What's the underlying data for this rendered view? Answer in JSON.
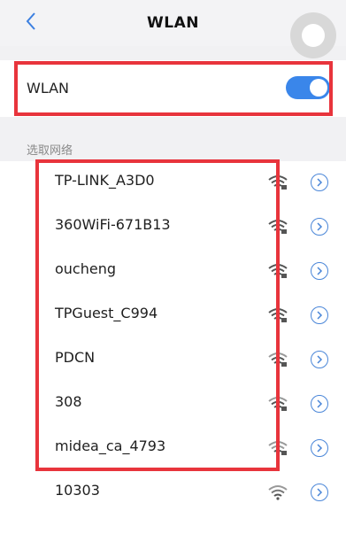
{
  "header": {
    "title": "WLAN",
    "back_icon": "chevron-left-icon"
  },
  "wlan_toggle": {
    "label": "WLAN",
    "state": "on",
    "accent": "#3a86ea"
  },
  "networks_section": {
    "label": "选取网络",
    "networks": [
      {
        "name": "TP-LINK_A3D0"
      },
      {
        "name": "360WiFi-671B13"
      },
      {
        "name": "oucheng"
      },
      {
        "name": "TPGuest_C994"
      },
      {
        "name": "PDCN"
      },
      {
        "name": "308"
      },
      {
        "name": "midea_ca_4793"
      },
      {
        "name": "10303"
      }
    ]
  },
  "highlight_color": "#e8343c"
}
